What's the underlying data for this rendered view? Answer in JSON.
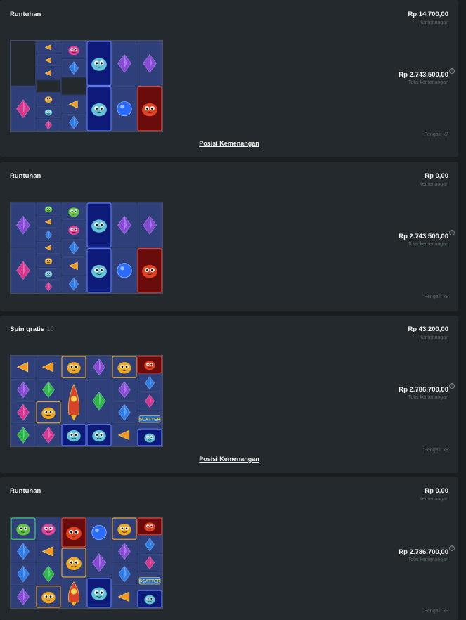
{
  "cards": [
    {
      "title": "Runtuhan",
      "subtitle": "",
      "win_value": "Rp 14.700,00",
      "win_label": "Kemenangan",
      "total_value": "Rp 2.743.500,00",
      "total_label": "Total kemenangan",
      "multiplier": "Pengali: x7",
      "link": "Posisi Kemenangan",
      "reels": [
        [
          {
            "s": "empty",
            "r": 3
          },
          {
            "s": "gem-pink",
            "r": 3
          }
        ],
        [
          {
            "s": "tri-orange",
            "r": 1
          },
          {
            "s": "tri-orange",
            "r": 1
          },
          {
            "s": "tri-orange",
            "r": 1
          },
          {
            "s": "empty",
            "r": 1
          },
          {
            "s": "alien-yellow",
            "r": 1
          },
          {
            "s": "alien-blue",
            "r": 1
          },
          {
            "s": "gem-pink",
            "r": 1
          }
        ],
        [
          {
            "s": "alien-pink",
            "r": 1
          },
          {
            "s": "gem-blue",
            "r": 1
          },
          {
            "s": "empty",
            "r": 1
          },
          {
            "s": "tri-orange",
            "r": 1
          },
          {
            "s": "gem-blue",
            "r": 1
          }
        ],
        [
          {
            "s": "alien-blue",
            "r": 3,
            "hl": "blue"
          },
          {
            "s": "alien-blue",
            "r": 3,
            "hl": "blue"
          }
        ],
        [
          {
            "s": "gem-purple",
            "r": 3
          },
          {
            "s": "orb-blue",
            "r": 3
          }
        ],
        [
          {
            "s": "gem-purple",
            "r": 3
          },
          {
            "s": "alien-red",
            "r": 3,
            "hl": "red"
          }
        ]
      ]
    },
    {
      "title": "Runtuhan",
      "subtitle": "",
      "win_value": "Rp 0,00",
      "win_label": "Kemenangan",
      "total_value": "Rp 2.743.500,00",
      "total_label": "Total kemenangan",
      "multiplier": "Pengali: x8",
      "link": "",
      "reels": [
        [
          {
            "s": "gem-purple",
            "r": 3
          },
          {
            "s": "gem-pink",
            "r": 3
          }
        ],
        [
          {
            "s": "alien-green",
            "r": 1
          },
          {
            "s": "tri-orange",
            "r": 1
          },
          {
            "s": "gem-blue",
            "r": 1
          },
          {
            "s": "tri-orange",
            "r": 1
          },
          {
            "s": "alien-yellow",
            "r": 1
          },
          {
            "s": "alien-blue",
            "r": 1
          },
          {
            "s": "gem-pink",
            "r": 1
          }
        ],
        [
          {
            "s": "alien-green",
            "r": 1
          },
          {
            "s": "alien-pink",
            "r": 1
          },
          {
            "s": "gem-blue",
            "r": 1
          },
          {
            "s": "tri-orange",
            "r": 1
          },
          {
            "s": "gem-blue",
            "r": 1
          }
        ],
        [
          {
            "s": "alien-blue",
            "r": 3,
            "hl": "blue"
          },
          {
            "s": "alien-blue",
            "r": 3,
            "hl": "blue"
          }
        ],
        [
          {
            "s": "gem-purple",
            "r": 3
          },
          {
            "s": "orb-blue",
            "r": 3
          }
        ],
        [
          {
            "s": "gem-purple",
            "r": 3
          },
          {
            "s": "alien-red",
            "r": 3,
            "hl": "red"
          }
        ]
      ]
    },
    {
      "title": "Spin gratis",
      "subtitle": "10",
      "win_value": "Rp 43.200,00",
      "win_label": "Kemenangan",
      "total_value": "Rp 2.786.700,00",
      "total_label": "Total kemenangan",
      "multiplier": "Pengali: x8",
      "link": "Posisi Kemenangan",
      "reels": [
        [
          {
            "s": "tri-orange",
            "r": 1
          },
          {
            "s": "gem-purple",
            "r": 1
          },
          {
            "s": "gem-pink",
            "r": 1
          },
          {
            "s": "gem-green",
            "r": 1
          }
        ],
        [
          {
            "s": "tri-orange",
            "r": 1
          },
          {
            "s": "gem-green",
            "r": 1
          },
          {
            "s": "alien-yellow",
            "r": 1,
            "hl": "gold"
          },
          {
            "s": "gem-pink",
            "r": 1
          }
        ],
        [
          {
            "s": "alien-yellow",
            "r": 1,
            "hl": "gold"
          },
          {
            "s": "rocket",
            "r": 2
          },
          {
            "s": "alien-blue",
            "r": 1,
            "hl": "blue"
          }
        ],
        [
          {
            "s": "gem-purple",
            "r": 1
          },
          {
            "s": "gem-green",
            "r": 2
          },
          {
            "s": "alien-blue",
            "r": 1,
            "hl": "blue"
          }
        ],
        [
          {
            "s": "alien-yellow",
            "r": 1,
            "hl": "gold"
          },
          {
            "s": "gem-purple",
            "r": 1
          },
          {
            "s": "gem-blue",
            "r": 1
          },
          {
            "s": "tri-orange",
            "r": 1
          }
        ],
        [
          {
            "s": "alien-red",
            "r": 1,
            "hl": "red"
          },
          {
            "s": "gem-blue",
            "r": 1
          },
          {
            "s": "gem-pink",
            "r": 1
          },
          {
            "s": "scatter",
            "r": 1
          },
          {
            "s": "alien-blue",
            "r": 1,
            "hl": "blue"
          }
        ]
      ]
    },
    {
      "title": "Runtuhan",
      "subtitle": "",
      "win_value": "Rp 0,00",
      "win_label": "Kemenangan",
      "total_value": "Rp 2.786.700,00",
      "total_label": "Total kemenangan",
      "multiplier": "Pengali: x9",
      "link": "",
      "reels": [
        [
          {
            "s": "alien-green",
            "r": 1,
            "hl": "green"
          },
          {
            "s": "gem-blue",
            "r": 1
          },
          {
            "s": "gem-blue",
            "r": 1
          },
          {
            "s": "gem-purple",
            "r": 1
          }
        ],
        [
          {
            "s": "alien-pink",
            "r": 1
          },
          {
            "s": "tri-orange",
            "r": 1
          },
          {
            "s": "gem-green",
            "r": 1
          },
          {
            "s": "alien-yellow",
            "r": 1,
            "hl": "gold"
          }
        ],
        [
          {
            "s": "alien-red",
            "r": 1,
            "hl": "red"
          },
          {
            "s": "alien-yellow",
            "r": 1,
            "hl": "gold"
          },
          {
            "s": "rocket",
            "r": 1
          }
        ],
        [
          {
            "s": "orb-blue",
            "r": 1
          },
          {
            "s": "gem-purple",
            "r": 1
          },
          {
            "s": "alien-blue",
            "r": 1,
            "hl": "blue"
          }
        ],
        [
          {
            "s": "alien-yellow",
            "r": 1,
            "hl": "gold"
          },
          {
            "s": "gem-purple",
            "r": 1
          },
          {
            "s": "gem-blue",
            "r": 1
          },
          {
            "s": "tri-orange",
            "r": 1
          }
        ],
        [
          {
            "s": "alien-red",
            "r": 1,
            "hl": "red"
          },
          {
            "s": "gem-blue",
            "r": 1
          },
          {
            "s": "gem-pink",
            "r": 1
          },
          {
            "s": "scatter",
            "r": 1
          },
          {
            "s": "alien-blue",
            "r": 1,
            "hl": "blue"
          }
        ]
      ]
    }
  ],
  "symbol_text": {
    "scatter": "SCATTER"
  },
  "colors": {
    "card_bg": "#23292c",
    "page_bg": "#1a1e21",
    "gem-purple": "#8a4ad8",
    "gem-pink": "#d8358f",
    "gem-blue": "#2f7de8",
    "gem-green": "#2fb84a",
    "orb-blue": "#2a6cff",
    "tri-orange": "#f39a1e",
    "alien-blue": "#63c3d6",
    "alien-pink": "#e24596",
    "alien-green": "#5ec63c",
    "alien-yellow": "#f0a81c",
    "alien-red": "#e2431e",
    "rocket": "#d6452a"
  }
}
